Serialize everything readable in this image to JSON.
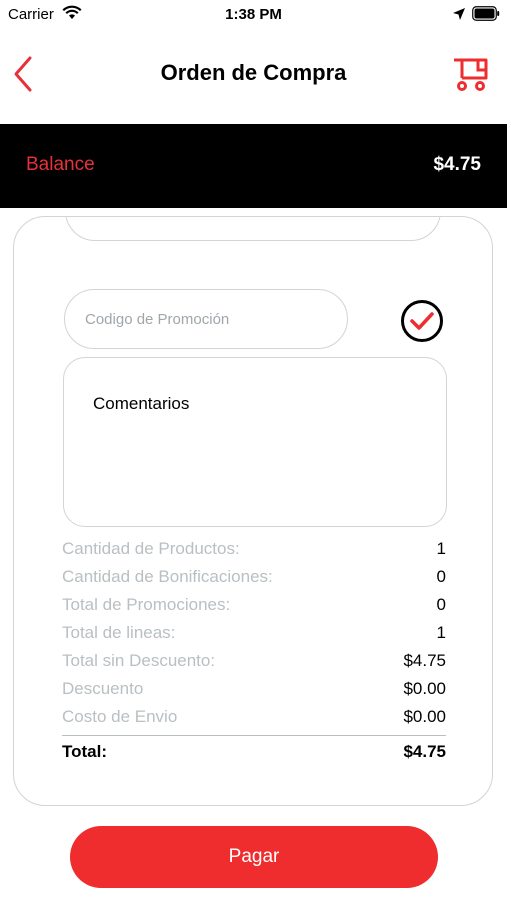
{
  "status": {
    "carrier": "Carrier",
    "time": "1:38 PM"
  },
  "nav": {
    "title": "Orden de Compra"
  },
  "balance": {
    "label": "Balance",
    "value": "$4.75"
  },
  "form": {
    "promo_placeholder": "Codigo de Promoción",
    "comments_label": "Comentarios"
  },
  "summary": {
    "rows": [
      {
        "label": "Cantidad de Productos:",
        "value": "1"
      },
      {
        "label": "Cantidad de Bonificaciones:",
        "value": "0"
      },
      {
        "label": "Total de Promociones:",
        "value": "0"
      },
      {
        "label": "Total de lineas:",
        "value": "1"
      },
      {
        "label": "Total sin Descuento:",
        "value": "$4.75"
      },
      {
        "label": "Descuento",
        "value": "$0.00"
      },
      {
        "label": "Costo de Envio",
        "value": "$0.00"
      }
    ],
    "total_label": "Total:",
    "total_value": "$4.75"
  },
  "pay_button": {
    "label": "Pagar"
  },
  "colors": {
    "accent": "#ef2d2f",
    "balance_label": "#e8303a",
    "muted": "#b9bfc2",
    "border": "#cfd5d8"
  },
  "icons": {
    "back": "chevron-left-icon",
    "cart": "cart-icon",
    "confirm": "check-circle-icon"
  }
}
